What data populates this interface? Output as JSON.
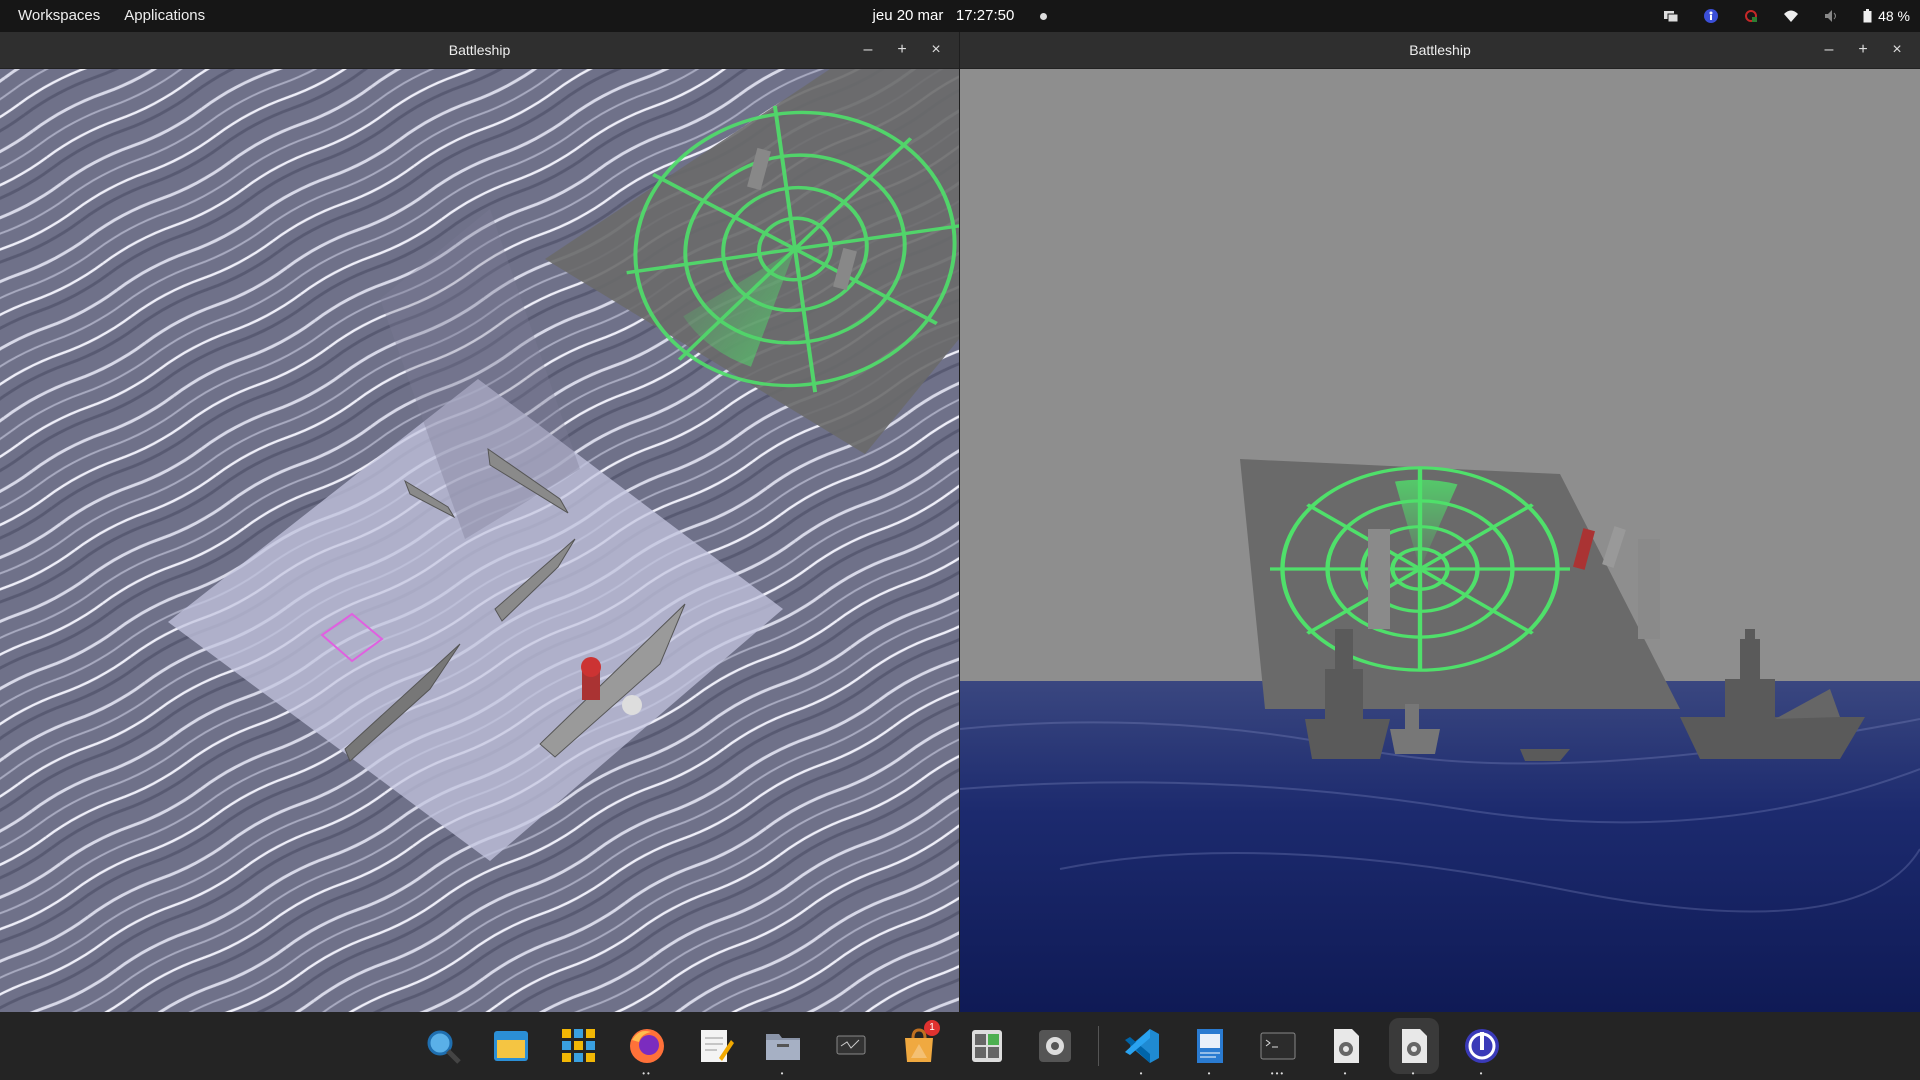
{
  "topbar": {
    "workspaces": "Workspaces",
    "applications": "Applications",
    "date": "jeu 20 mar",
    "time": "17:27:50",
    "battery": "48 %"
  },
  "windows": [
    {
      "title": "Battleship",
      "minimize": "–",
      "maximize": "+",
      "close": "×"
    },
    {
      "title": "Battleship",
      "minimize": "–",
      "maximize": "+",
      "close": "×"
    }
  ],
  "dock": {
    "apps": [
      {
        "name": "search-app-icon",
        "running": ""
      },
      {
        "name": "file-manager-icon",
        "running": ""
      },
      {
        "name": "app-grid-icon",
        "running": ""
      },
      {
        "name": "firefox-icon",
        "running": "••"
      },
      {
        "name": "text-editor-icon",
        "running": ""
      },
      {
        "name": "files-icon",
        "running": "•"
      },
      {
        "name": "monitor-icon",
        "running": ""
      },
      {
        "name": "appcenter-icon",
        "running": "",
        "badge": "1"
      },
      {
        "name": "calculator-icon",
        "running": ""
      },
      {
        "name": "settings-icon",
        "running": ""
      },
      {
        "name": "vscode-icon",
        "running": "•"
      },
      {
        "name": "document-viewer-icon",
        "running": "•"
      },
      {
        "name": "terminal-icon",
        "running": "•••"
      },
      {
        "name": "config-file-icon",
        "running": "•"
      },
      {
        "name": "config-file-icon-2",
        "running": "•"
      },
      {
        "name": "tweaks-icon",
        "running": "•"
      }
    ]
  },
  "colors": {
    "radar_green": "#4fe06a",
    "sea_left": "#7b7d96",
    "sea_right": "#1c2a6e",
    "sky_right": "#8e8e8e",
    "selector": "#e060e0"
  }
}
